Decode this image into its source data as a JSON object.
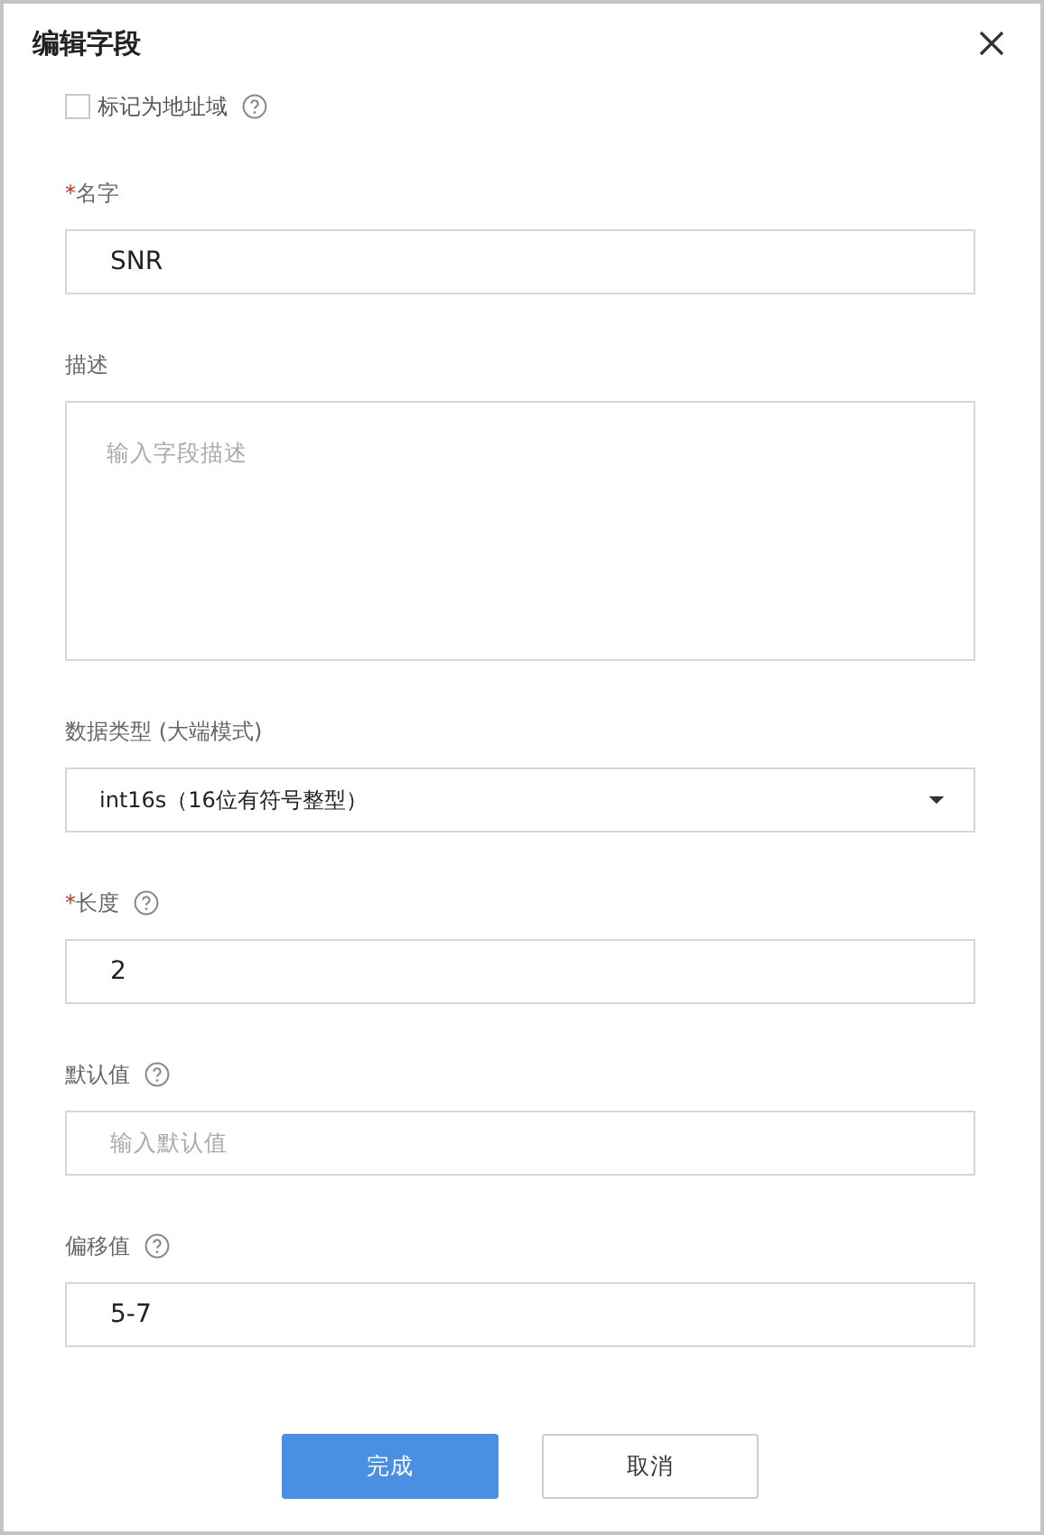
{
  "dialog": {
    "title": "编辑字段"
  },
  "address_checkbox": {
    "label": "标记为地址域",
    "checked": false,
    "help": true
  },
  "fields": [
    {
      "kind": "text",
      "required_mark": "*",
      "label": "名字",
      "help": false,
      "value": "SNR"
    },
    {
      "kind": "textarea",
      "label": "描述",
      "help": false,
      "placeholder": "输入字段描述"
    },
    {
      "kind": "select",
      "label": "数据类型 (大端模式)",
      "help": false,
      "value": "int16s（16位有符号整型）"
    },
    {
      "kind": "text",
      "required_mark": "*",
      "label": "长度",
      "help": true,
      "value": "2"
    },
    {
      "kind": "text",
      "label": "默认值",
      "help": true,
      "placeholder": "输入默认值"
    },
    {
      "kind": "text",
      "label": "偏移值",
      "help": true,
      "value": "5-7"
    }
  ],
  "buttons": [
    {
      "label": "完成",
      "kind": "primary"
    },
    {
      "label": "取消",
      "kind": "secondary"
    }
  ]
}
